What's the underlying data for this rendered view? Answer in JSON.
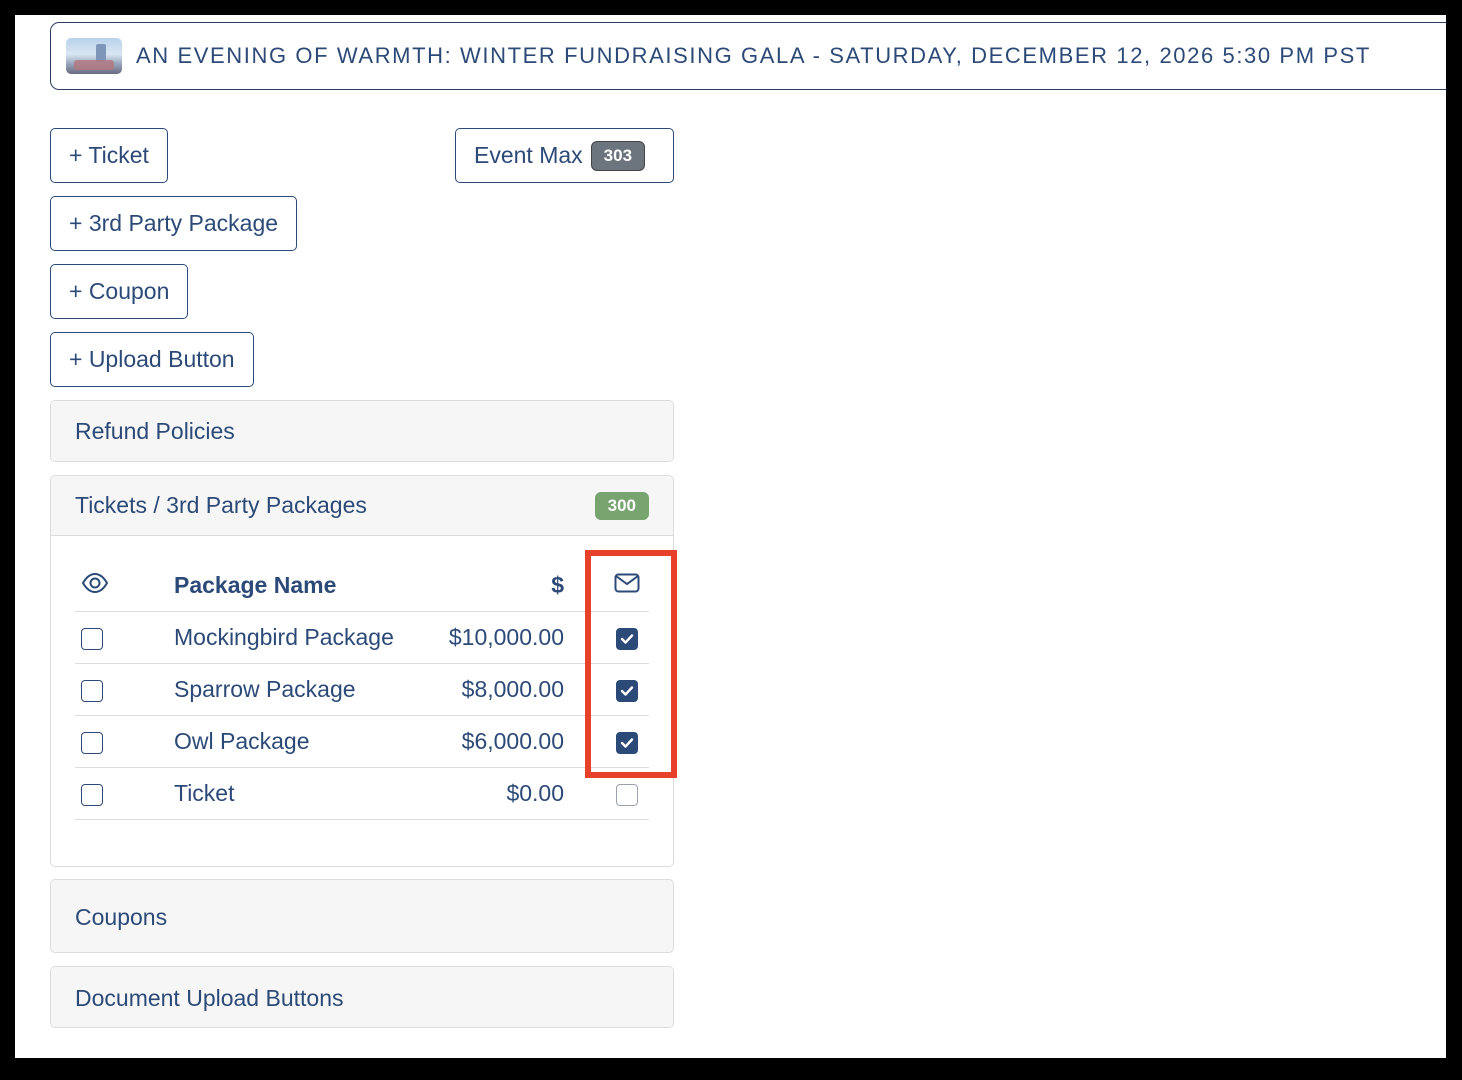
{
  "event": {
    "title": "AN EVENING OF WARMTH: WINTER FUNDRAISING GALA - SATURDAY, DECEMBER 12, 2026 5:30 PM PST"
  },
  "buttons": {
    "ticket": "+ Ticket",
    "third_party": "+ 3rd Party Package",
    "coupon": "+ Coupon",
    "upload": "+ Upload Button",
    "event_max_label": "Event Max",
    "event_max_value": "303"
  },
  "panels": {
    "refund": "Refund Policies",
    "tickets": "Tickets / 3rd Party Packages",
    "tickets_count": "300",
    "coupons": "Coupons",
    "documents": "Document Upload Buttons"
  },
  "table": {
    "headers": {
      "visibility_icon": "eye-icon",
      "name": "Package Name",
      "price": "$",
      "email_icon": "envelope-icon"
    },
    "rows": [
      {
        "name": "Mockingbird Package",
        "price": "$10,000.00",
        "visible": false,
        "email": true
      },
      {
        "name": "Sparrow Package",
        "price": "$8,000.00",
        "visible": false,
        "email": true
      },
      {
        "name": "Owl Package",
        "price": "$6,000.00",
        "visible": false,
        "email": true
      },
      {
        "name": "Ticket",
        "price": "$0.00",
        "visible": false,
        "email": false
      }
    ]
  },
  "colors": {
    "primary": "#2c4a78",
    "count_badge": "#78a46f",
    "max_badge": "#6c757d",
    "highlight": "#e8412b"
  }
}
